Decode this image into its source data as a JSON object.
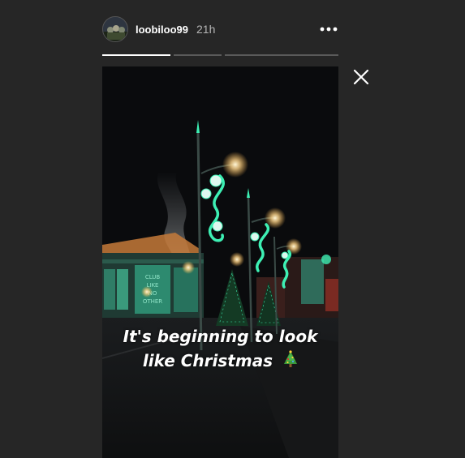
{
  "header": {
    "username": "loobiloo99",
    "time_ago": "21h",
    "avatar_icon": "profile-avatar",
    "more_icon": "more-options-icon"
  },
  "progress": {
    "segments": [
      {
        "fill_fraction": 1.0
      },
      {
        "fill_fraction": 0.0
      },
      {
        "fill_fraction": 0.0
      }
    ]
  },
  "story": {
    "caption_line1": "It's beginning to look",
    "caption_line2": "like Christmas",
    "caption_emoji": "christmas-tree-icon",
    "scene_text": "CLUB LIKE NO OTHER"
  },
  "controls": {
    "close_icon": "close-icon"
  },
  "colors": {
    "background": "#262626",
    "text": "#ffffff",
    "muted": "#b5b5b5",
    "neon": "#3df0b4"
  }
}
